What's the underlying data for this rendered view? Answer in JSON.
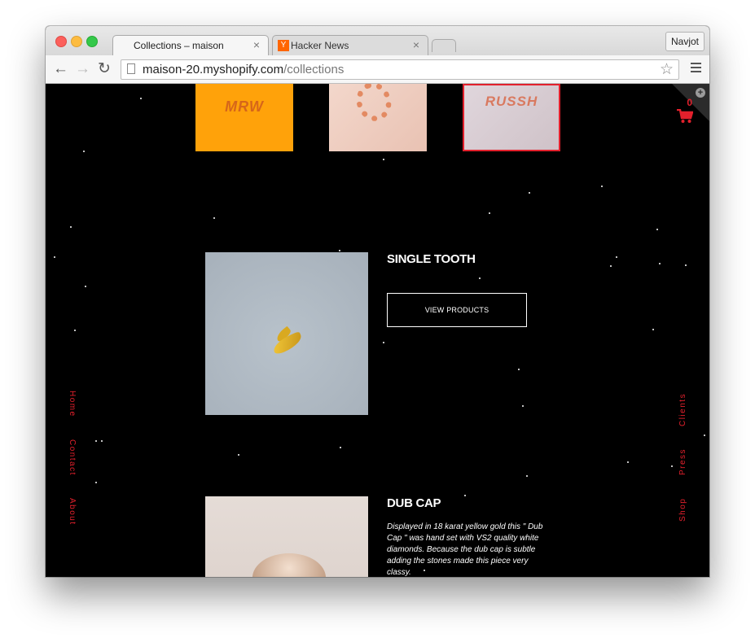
{
  "browser": {
    "tabs": [
      {
        "title": "Collections – maison",
        "close": "×"
      },
      {
        "title": "Hacker News",
        "favicon": "Y",
        "close": "×"
      }
    ],
    "profile_name": "Navjot",
    "url_host": "maison-20.myshopify.com",
    "url_path": "/collections",
    "nav": {
      "back": "←",
      "forward": "→",
      "reload": "↻",
      "star": "☆"
    }
  },
  "page": {
    "thumbnails": [
      {
        "name": "orange-collection",
        "text": "MRW",
        "color": "#ffa20a"
      },
      {
        "name": "chain-ring-collection",
        "color": "#f0d2c5"
      },
      {
        "name": "script-ring-collection",
        "text": "RUSSH",
        "color": "#d8ccd2",
        "selected": true
      }
    ],
    "cart": {
      "count": "0",
      "plus": "+"
    },
    "products": [
      {
        "title": "SINGLE TOOTH",
        "button": "VIEW PRODUCTS"
      },
      {
        "title": "DUB CAP",
        "description": "Displayed in 18 karat yellow gold this \" Dub Cap \" was hand set with VS2 quality white diamonds. Because the dub cap is subtle adding the stones made this piece very classy."
      }
    ],
    "left_nav": [
      "Home",
      "Contact",
      "About"
    ],
    "right_nav": [
      "Clients",
      "Press",
      "Shop"
    ],
    "accent_color": "#e2202c"
  }
}
